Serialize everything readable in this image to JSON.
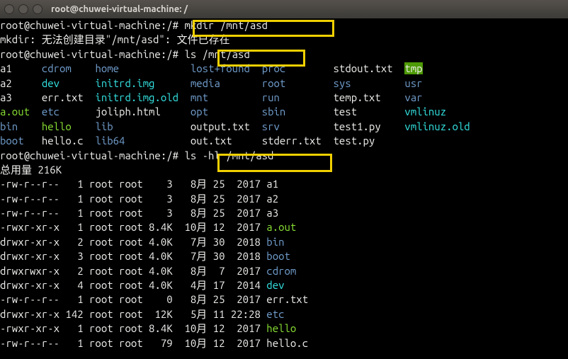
{
  "titlebar": {
    "title": "root@chuwei-virtual-machine: /"
  },
  "prompt_host": "root@chuwei-virtual-machine",
  "prompt_path": "/",
  "cmd1": "mkdir /mnt/asd",
  "mkdir_err": "mkdir: 无法创建目录\"/mnt/asd\": 文件已存在",
  "cmd2": "ls /mnt/asd",
  "cmd3": "ls -hl /mnt/asd",
  "total_line_label": "总用量",
  "total_line_value": "216K",
  "ls_cols": [
    [
      "a1",
      "cdrom",
      "home",
      "lost+found",
      "proc",
      "stdout.txt",
      "tmp"
    ],
    [
      "a2",
      "dev",
      "initrd.img",
      "media",
      "root",
      "sys",
      "usr"
    ],
    [
      "a3",
      "err.txt",
      "initrd.img.old",
      "mnt",
      "run",
      "temp.txt",
      "var"
    ],
    [
      "a.out",
      "etc",
      "joliph.html",
      "opt",
      "sbin",
      "test",
      "vmlinuz"
    ],
    [
      "bin",
      "hello",
      "lib",
      "output.txt",
      "srv",
      "test1.py",
      "vmlinuz.old"
    ],
    [
      "boot",
      "hello.c",
      "lib64",
      "out.txt",
      "stderr.txt",
      "test.py",
      ""
    ]
  ],
  "ls_col_classes": [
    [
      "w",
      "bl",
      "bl",
      "bl",
      "bl",
      "w",
      "hl"
    ],
    [
      "w",
      "cy",
      "cy",
      "bl",
      "bl",
      "bl",
      "bl"
    ],
    [
      "w",
      "w",
      "cy",
      "bl",
      "bl",
      "w",
      "bl"
    ],
    [
      "gr",
      "bl",
      "w",
      "bl",
      "bl",
      "w",
      "cy"
    ],
    [
      "bl",
      "gr",
      "bl",
      "w",
      "bl",
      "w",
      "cy"
    ],
    [
      "bl",
      "w",
      "bl",
      "w",
      "w",
      "w",
      "w"
    ]
  ],
  "hl_rows": [
    {
      "perm": "-rw-r--r--",
      "links": "1",
      "owner": "root",
      "group": "root",
      "size": "3",
      "mo": "8月",
      "day": "25",
      "time": "2017",
      "name": "a1",
      "nc": "w"
    },
    {
      "perm": "-rw-r--r--",
      "links": "1",
      "owner": "root",
      "group": "root",
      "size": "3",
      "mo": "8月",
      "day": "25",
      "time": "2017",
      "name": "a2",
      "nc": "w"
    },
    {
      "perm": "-rw-r--r--",
      "links": "1",
      "owner": "root",
      "group": "root",
      "size": "3",
      "mo": "8月",
      "day": "25",
      "time": "2017",
      "name": "a3",
      "nc": "w"
    },
    {
      "perm": "-rwxr-xr-x",
      "links": "1",
      "owner": "root",
      "group": "root",
      "size": "8.4K",
      "mo": "10月",
      "day": "12",
      "time": "2017",
      "name": "a.out",
      "nc": "gr"
    },
    {
      "perm": "drwxr-xr-x",
      "links": "2",
      "owner": "root",
      "group": "root",
      "size": "4.0K",
      "mo": "7月",
      "day": "30",
      "time": "2018",
      "name": "bin",
      "nc": "bl"
    },
    {
      "perm": "drwxr-xr-x",
      "links": "3",
      "owner": "root",
      "group": "root",
      "size": "4.0K",
      "mo": "7月",
      "day": "30",
      "time": "2018",
      "name": "boot",
      "nc": "bl"
    },
    {
      "perm": "drwxrwxr-x",
      "links": "2",
      "owner": "root",
      "group": "root",
      "size": "4.0K",
      "mo": "8月",
      "day": "7",
      "time": "2017",
      "name": "cdrom",
      "nc": "bl"
    },
    {
      "perm": "drwxr-xr-x",
      "links": "4",
      "owner": "root",
      "group": "root",
      "size": "4.0K",
      "mo": "4月",
      "day": "17",
      "time": "2014",
      "name": "dev",
      "nc": "cy"
    },
    {
      "perm": "-rw-r--r--",
      "links": "1",
      "owner": "root",
      "group": "root",
      "size": "0",
      "mo": "8月",
      "day": "25",
      "time": "2017",
      "name": "err.txt",
      "nc": "w"
    },
    {
      "perm": "drwxr-xr-x",
      "links": "142",
      "owner": "root",
      "group": "root",
      "size": "12K",
      "mo": "5月",
      "day": "11",
      "time": "22:28",
      "name": "etc",
      "nc": "bl"
    },
    {
      "perm": "-rwxr-xr-x",
      "links": "1",
      "owner": "root",
      "group": "root",
      "size": "8.4K",
      "mo": "10月",
      "day": "12",
      "time": "2017",
      "name": "hello",
      "nc": "gr"
    },
    {
      "perm": "-rw-r--r--",
      "links": "1",
      "owner": "root",
      "group": "root",
      "size": "79",
      "mo": "10月",
      "day": "12",
      "time": "2017",
      "name": "hello.c",
      "nc": "w"
    }
  ]
}
